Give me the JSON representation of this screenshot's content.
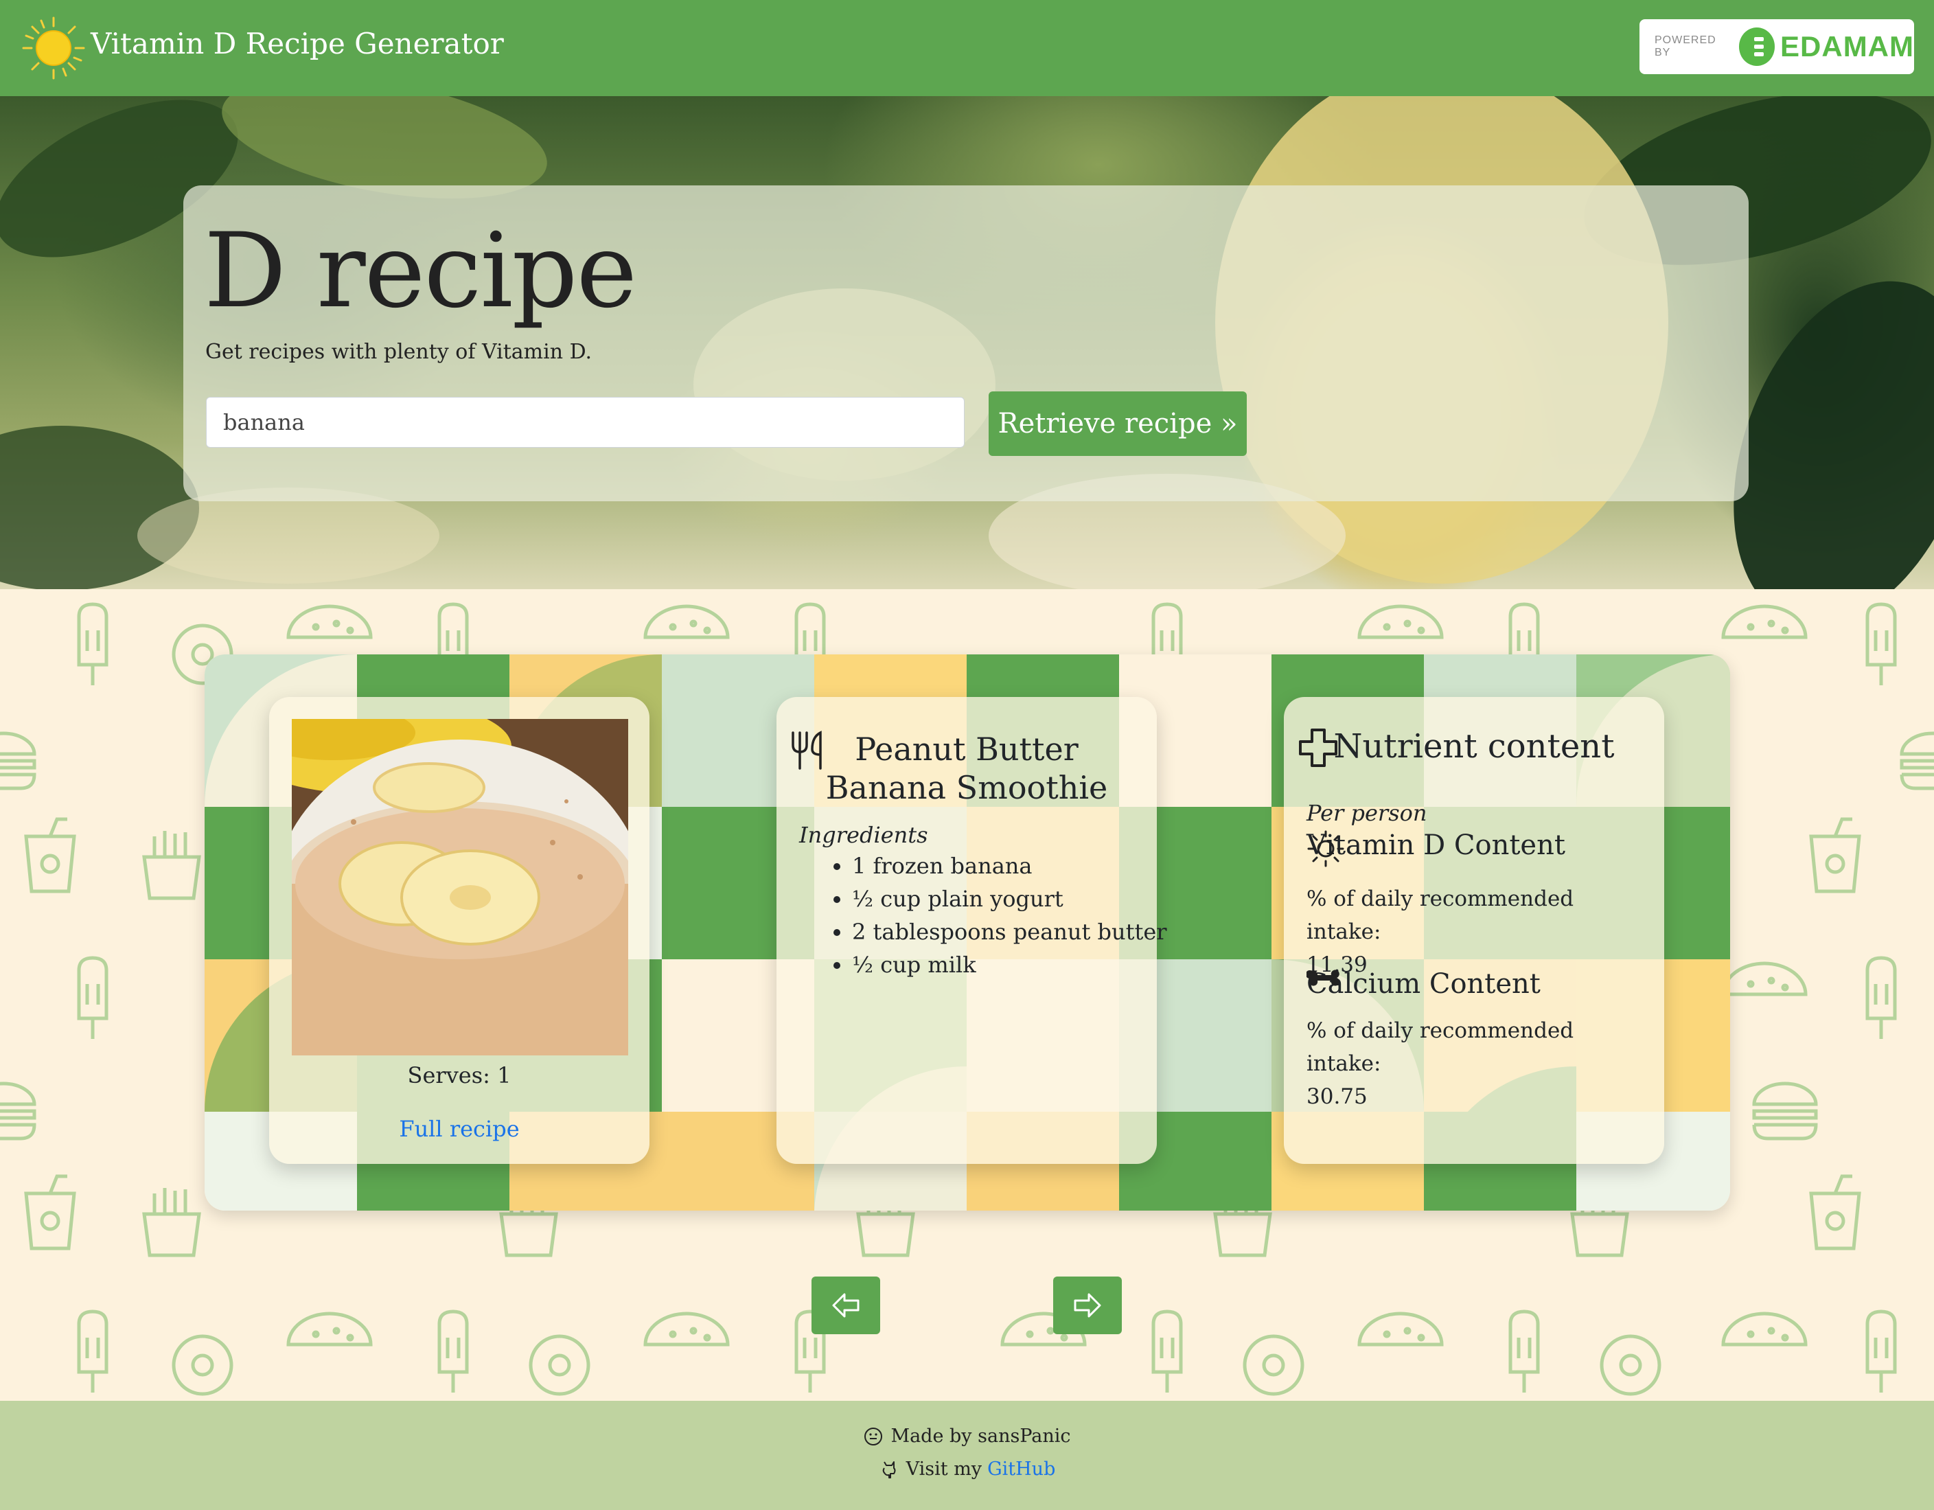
{
  "navbar": {
    "title": "Vitamin D Recipe Generator",
    "powered_by": "POWERED BY",
    "provider": "EDAMAM",
    "brand_color": "#5da650",
    "provider_color": "#58b947"
  },
  "hero": {
    "heading": "D recipe",
    "lead": "Get recipes with plenty of Vitamin D.",
    "search_value": "banana",
    "button_label": "Retrieve recipe »"
  },
  "recipe": {
    "serves_text": "Serves: 1",
    "full_recipe_label": "Full recipe",
    "title": "Peanut Butter Banana Smoothie",
    "ingredients_label": "Ingredients",
    "ingredients": [
      "1 frozen banana",
      "½ cup plain yogurt",
      "2 tablespoons peanut butter",
      "½ cup milk"
    ]
  },
  "nutrients": {
    "title": "Nutrient content",
    "per_label": "Per person",
    "vitamin_d_heading": "Vitamin D Content",
    "vitamin_d_label": "% of daily recommended intake:",
    "vitamin_d_value": "11.39",
    "calcium_heading": "Calcium Content",
    "calcium_label": "% of daily recommended intake:",
    "calcium_value": "30.75"
  },
  "pager": {
    "prev_icon": "arrow-left-icon",
    "next_icon": "arrow-right-icon"
  },
  "footer": {
    "made_by": "Made by sansPanic",
    "visit_prefix": "Visit my",
    "github_label": "GitHub"
  }
}
